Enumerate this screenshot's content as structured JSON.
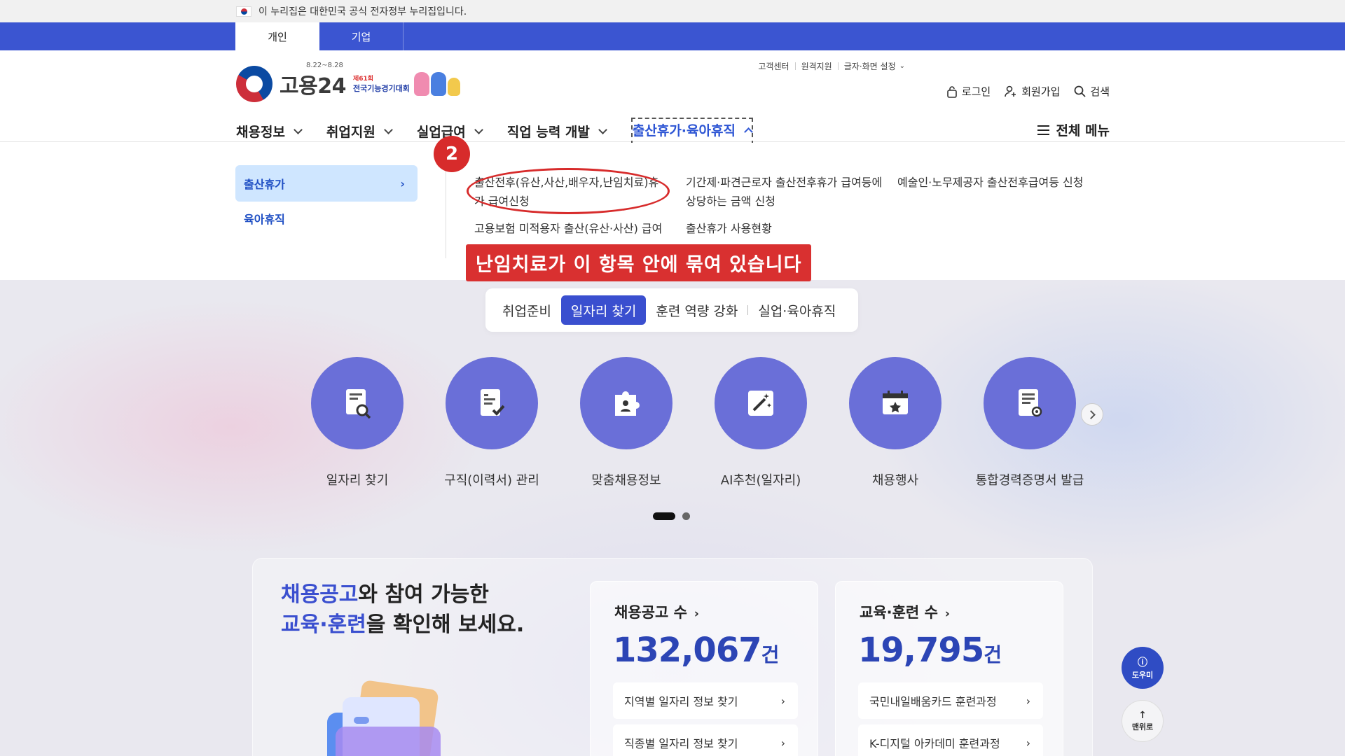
{
  "gov_notice": "이 누리집은 대한민국 공식 전자정부 누리집입니다.",
  "audience_tabs": [
    "개인",
    "기업"
  ],
  "logo": {
    "text": "고용24",
    "date": "8.22~8.28",
    "event_small": "제61회",
    "event_title": "전국기능경기대회"
  },
  "utils": [
    "고객센터",
    "원격지원",
    "글자·화면 설정"
  ],
  "user_links": {
    "login": "로그인",
    "signup": "회원가입",
    "search": "검색"
  },
  "gnb": [
    "채용정보",
    "취업지원",
    "실업급여",
    "직업 능력 개발",
    "출산휴가·육아휴직"
  ],
  "all_menu": "전체 메뉴",
  "dropdown": {
    "side_active": "출산휴가",
    "side_other": "육아휴직",
    "links": [
      "출산전후(유산,사산,배우자,난임치료)휴가 급여신청",
      "기간제·파견근로자 출산전후휴가 급여등에 상당하는 금액 신청",
      "예술인·노무제공자 출산전후급여등 신청",
      "고용보험 미적용자 출산(유산·사산) 급여 신청",
      "출산휴가 사용현황"
    ]
  },
  "annotation": {
    "badge": "2",
    "callout": "난임치료가 이 항목 안에 묶여 있습니다",
    "color": "#d72b2b"
  },
  "category_tabs": [
    "취업준비",
    "일자리 찾기",
    "훈련 역량 강화",
    "실업·육아휴직"
  ],
  "services": [
    {
      "label": "일자리 찾기",
      "icon": "job-search-icon"
    },
    {
      "label": "구직(이력서) 관리",
      "icon": "resume-check-icon"
    },
    {
      "label": "맞춤채용정보",
      "icon": "puzzle-person-icon"
    },
    {
      "label": "AI추천(일자리)",
      "icon": "magic-wand-icon"
    },
    {
      "label": "채용행사",
      "icon": "calendar-star-icon"
    },
    {
      "label": "통합경력증명서 발급",
      "icon": "certificate-icon"
    }
  ],
  "headline": {
    "l1_hl": "채용공고",
    "l1": "와 참여 가능한",
    "l2_hl": "교육·훈련",
    "l2": "을 확인해 보세요."
  },
  "stats": [
    {
      "title": "채용공고 수",
      "value": "132,067",
      "unit": "건",
      "links": [
        "지역별 일자리 정보 찾기",
        "직종별 일자리 정보 찾기"
      ]
    },
    {
      "title": "교육·훈련 수",
      "value": "19,795",
      "unit": "건",
      "links": [
        "국민내일배움카드 훈련과정",
        "K-디지털 아카데미 훈련과정"
      ]
    }
  ],
  "floating": {
    "help": "도우미",
    "top": "맨위로"
  },
  "colors": {
    "primary": "#3b55d1",
    "circle": "#6a6fd8",
    "stat": "#2c45b5"
  }
}
